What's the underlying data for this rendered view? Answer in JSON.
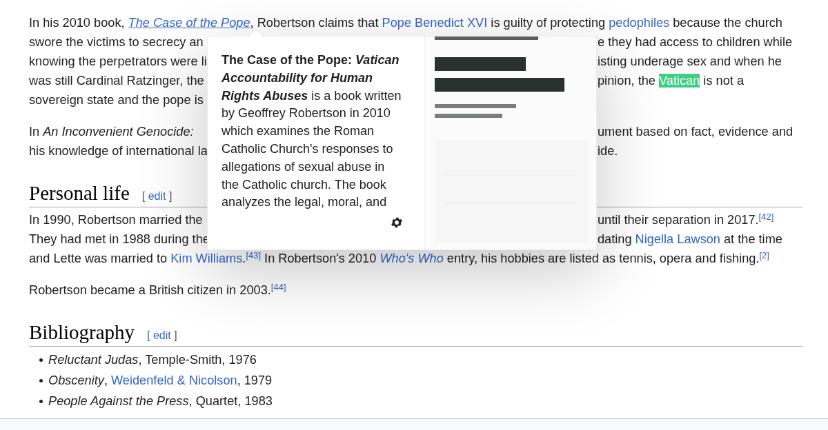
{
  "article": {
    "paragraphs": [
      {
        "lines": [
          {
            "full": [
              {
                "text": "In his 2010 book, ",
                "kind": "plain"
              },
              {
                "text": "The Case of the Pope",
                "kind": "hovered-italic-link"
              },
              {
                "text": ", Robertson claims that ",
                "kind": "plain"
              },
              {
                "text": "Pope Benedict XVI",
                "kind": "link"
              },
              {
                "text": " is guilty of protecting ",
                "kind": "plain"
              },
              {
                "text": "pedophiles",
                "kind": "link"
              },
              {
                "text": " because the church",
                "kind": "plain"
              }
            ]
          },
          {
            "left": [
              {
                "text": "swore the victims to secrecy an",
                "kind": "plain"
              }
            ],
            "right": [
              {
                "text": "e they had access to children while",
                "kind": "plain"
              }
            ]
          },
          {
            "left": [
              {
                "text": "knowing the perpetrators were li",
                "kind": "plain"
              }
            ],
            "right": [
              {
                "text": "isting underage sex and when he",
                "kind": "plain"
              }
            ]
          },
          {
            "left": [
              {
                "text": "was still Cardinal Ratzinger, the",
                "kind": "plain"
              }
            ],
            "right": [
              {
                "text": "pinion, the ",
                "kind": "plain"
              },
              {
                "text": "Vatican",
                "kind": "highlighted-link"
              },
              {
                "text": " is not a",
                "kind": "plain"
              }
            ]
          },
          {
            "left": [
              {
                "text": "sovereign state and the pope is",
                "kind": "plain"
              }
            ]
          }
        ]
      },
      {
        "lines": [
          {
            "left": [
              {
                "text": "In ",
                "kind": "plain"
              },
              {
                "text": "An Inconvenient Genocide:",
                "kind": "italic"
              }
            ],
            "right": [
              {
                "text": "ument based on fact, evidence and",
                "kind": "plain"
              }
            ]
          },
          {
            "left": [
              {
                "text": "his knowledge of international la",
                "kind": "plain"
              }
            ],
            "right": [
              {
                "text": "ide.",
                "kind": "plain"
              }
            ]
          }
        ]
      },
      {
        "heading": {
          "title": "Personal life",
          "open": "[",
          "edit": "edit",
          "close": "]"
        }
      },
      {
        "lines": [
          {
            "left": [
              {
                "text": "In 1990, Robertson married the",
                "kind": "plain"
              }
            ],
            "right": [
              {
                "text": "until their separation in 2017.",
                "kind": "plain"
              },
              {
                "text": "[42]",
                "kind": "ref"
              }
            ]
          },
          {
            "left": [
              {
                "text": "They had met in 1988 during the",
                "kind": "plain"
              }
            ],
            "right": [
              {
                "text": "dating ",
                "kind": "plain"
              },
              {
                "text": "Nigella Lawson",
                "kind": "link"
              },
              {
                "text": " at the time",
                "kind": "plain"
              }
            ]
          },
          {
            "full": [
              {
                "text": "and Lette was married to ",
                "kind": "plain"
              },
              {
                "text": "Kim Williams",
                "kind": "link"
              },
              {
                "text": ".",
                "kind": "plain"
              },
              {
                "text": "[43]",
                "kind": "ref"
              },
              {
                "text": " In Robertson's 2010 ",
                "kind": "plain"
              },
              {
                "text": "Who's Who",
                "kind": "italic-link"
              },
              {
                "text": " entry, his hobbies are listed as tennis, opera and fishing.",
                "kind": "plain"
              },
              {
                "text": "[2]",
                "kind": "ref"
              }
            ]
          }
        ]
      },
      {
        "lines": [
          {
            "full": [
              {
                "text": "Robertson became a British citizen in 2003.",
                "kind": "plain"
              },
              {
                "text": "[44]",
                "kind": "ref"
              }
            ]
          }
        ]
      },
      {
        "heading": {
          "title": "Bibliography",
          "open": "[",
          "edit": "edit",
          "close": "]"
        }
      },
      {
        "bullets": [
          [
            {
              "text": "*Reluctant Judas*, Temple-Smith, 1976",
              "kind": "plain"
            }
          ],
          [
            {
              "text": "*Obscenity*, ",
              "kind": "plain"
            },
            {
              "text": "Weidenfeld & Nicolson",
              "kind": "link"
            },
            {
              "text": ", 1979",
              "kind": "plain"
            }
          ],
          [
            {
              "text": "*People Against the Press*, Quartet, 1983",
              "kind": "plain"
            }
          ]
        ]
      }
    ]
  },
  "preview_popup": {
    "extract": [
      {
        "text": "The Case of the Pope: ",
        "kind": "bold"
      },
      {
        "text": "Vatican Accountability for Human Rights Abuses",
        "kind": "bold-italic"
      },
      {
        "text": " is a book written by Geoffrey Robertson in 2010 which examines the Roman Catholic Church's responses to allegations of sexual abuse in the Catholic church. The book analyzes the legal, moral, and",
        "kind": "plain"
      }
    ]
  }
}
